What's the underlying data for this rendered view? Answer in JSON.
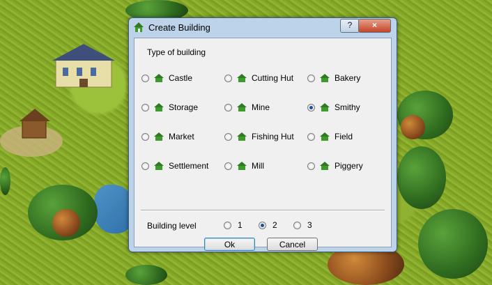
{
  "dialog": {
    "title": "Create Building",
    "help_label": "?",
    "close_label": "×"
  },
  "type_section": {
    "label": "Type of building",
    "options": [
      {
        "label": "Castle",
        "selected": false
      },
      {
        "label": "Cutting Hut",
        "selected": false
      },
      {
        "label": "Bakery",
        "selected": false
      },
      {
        "label": "Storage",
        "selected": false
      },
      {
        "label": "Mine",
        "selected": false
      },
      {
        "label": "Smithy",
        "selected": true
      },
      {
        "label": "Market",
        "selected": false
      },
      {
        "label": "Fishing Hut",
        "selected": false
      },
      {
        "label": "Field",
        "selected": false
      },
      {
        "label": "Settlement",
        "selected": false
      },
      {
        "label": "Mill",
        "selected": false
      },
      {
        "label": "Piggery",
        "selected": false
      }
    ]
  },
  "level_section": {
    "label": "Building level",
    "options": [
      {
        "label": "1",
        "selected": false
      },
      {
        "label": "2",
        "selected": true
      },
      {
        "label": "3",
        "selected": false
      }
    ]
  },
  "buttons": {
    "ok_label": "Ok",
    "cancel_label": "Cancel"
  },
  "icons": {
    "title_icon": "house-icon",
    "option_icon": "house-icon"
  },
  "colors": {
    "house_green": "#3f9a2e",
    "house_roof": "#2f7a22",
    "radio_dot": "#1f4f9c"
  }
}
